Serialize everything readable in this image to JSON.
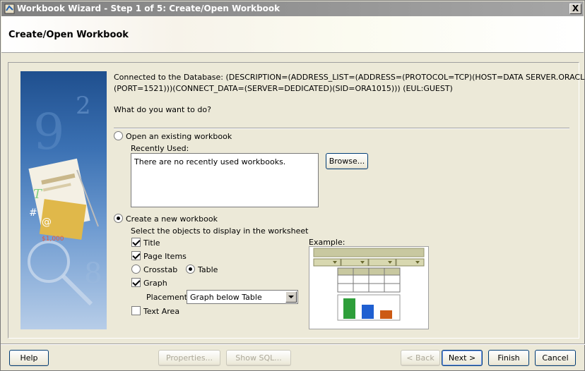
{
  "window": {
    "title": "Workbook Wizard - Step 1 of 5: Create/Open Workbook",
    "close_label": "X"
  },
  "header": {
    "title": "Create/Open Workbook"
  },
  "connection": {
    "line1": "Connected to the Database: (DESCRIPTION=(ADDRESS_LIST=(ADDRESS=(PROTOCOL=TCP)(HOST=DATA SERVER.ORACLE.COM)",
    "line2": "(PORT=1521)))(CONNECT_DATA=(SERVER=DEDICATED)(SID=ORA1015))) (EUL:GUEST)"
  },
  "question": "What do you want to do?",
  "open_existing": {
    "label": "Open an existing workbook",
    "selected": false,
    "recently_used_label": "Recently Used:",
    "recent_list_text": "There are no recently used workbooks.",
    "browse_label": "Browse..."
  },
  "create_new": {
    "label": "Create a new workbook",
    "selected": true,
    "select_objects_label": "Select the objects to display in the worksheet",
    "title_label": "Title",
    "title_checked": true,
    "page_items_label": "Page Items",
    "page_items_checked": true,
    "crosstab_label": "Crosstab",
    "crosstab_selected": false,
    "table_label": "Table",
    "table_selected": true,
    "graph_label": "Graph",
    "graph_checked": true,
    "placement_label": "Placement:",
    "placement_value": "Graph below Table",
    "text_area_label": "Text Area",
    "text_area_checked": false
  },
  "example": {
    "label": "Example:",
    "bar_colors": [
      "#2e9e3a",
      "#1f5fd1",
      "#cc5a14"
    ],
    "bar_values": [
      0.9,
      0.62,
      0.38
    ]
  },
  "buttons": {
    "help": "Help",
    "properties": "Properties...",
    "show_sql": "Show SQL...",
    "back": "< Back",
    "next": "Next >",
    "finish": "Finish",
    "cancel": "Cancel"
  },
  "colors": {
    "titlebar": "#808080",
    "dialog_bg": "#ece9d8",
    "header_bg": "#ffffff"
  }
}
